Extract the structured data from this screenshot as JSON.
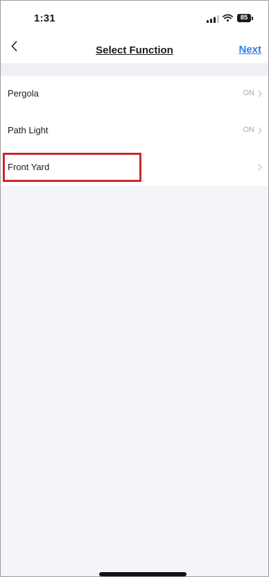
{
  "status_bar": {
    "time": "1:31",
    "battery": "85",
    "signal_icon": "cellular-signal-icon",
    "wifi_icon": "wifi-icon",
    "battery_icon": "battery-icon"
  },
  "nav": {
    "back_icon": "chevron-left-icon",
    "title": "Select Function",
    "next_label": "Next",
    "accent_color": "#2f7ae5"
  },
  "functions": [
    {
      "label": "Pergola",
      "status": "ON"
    },
    {
      "label": "Path Light",
      "status": "ON"
    },
    {
      "label": "Front Yard",
      "status": ""
    }
  ],
  "colors": {
    "highlight": "#c8282e",
    "background": "#f4f5f9",
    "status_text": "#a9a9a9"
  }
}
